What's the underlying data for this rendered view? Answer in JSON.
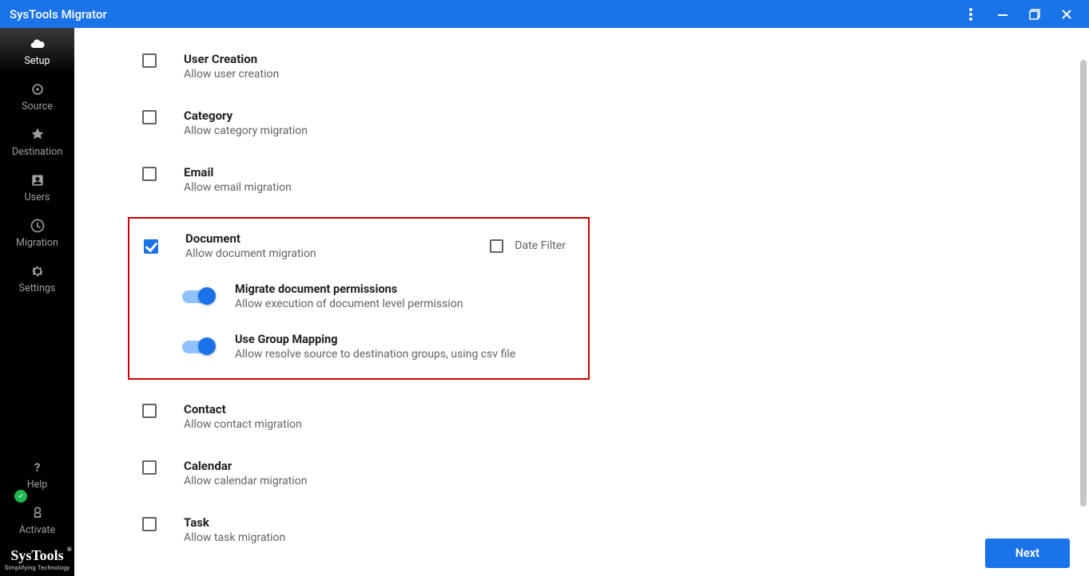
{
  "titlebar": {
    "title": "SysTools Migrator"
  },
  "sidebar": {
    "items": [
      {
        "label": "Setup"
      },
      {
        "label": "Source"
      },
      {
        "label": "Destination"
      },
      {
        "label": "Users"
      },
      {
        "label": "Migration"
      },
      {
        "label": "Settings"
      }
    ],
    "help": "Help",
    "activate": "Activate",
    "logo1": "SysTools",
    "logo2": "Simplifying Technology"
  },
  "options": {
    "user_creation": {
      "title": "User Creation",
      "desc": "Allow user creation"
    },
    "category": {
      "title": "Category",
      "desc": "Allow category migration"
    },
    "email": {
      "title": "Email",
      "desc": "Allow email migration"
    },
    "document": {
      "title": "Document",
      "desc": "Allow document migration",
      "date_filter_label": "Date Filter",
      "sub_perm": {
        "title": "Migrate document permissions",
        "desc": "Allow execution of document level permission"
      },
      "sub_group": {
        "title": "Use Group Mapping",
        "desc": "Allow resolve source to destination groups, using csv file"
      }
    },
    "contact": {
      "title": "Contact",
      "desc": "Allow contact migration"
    },
    "calendar": {
      "title": "Calendar",
      "desc": "Allow calendar migration"
    },
    "task": {
      "title": "Task",
      "desc": "Allow task migration"
    }
  },
  "footer": {
    "next": "Next"
  }
}
